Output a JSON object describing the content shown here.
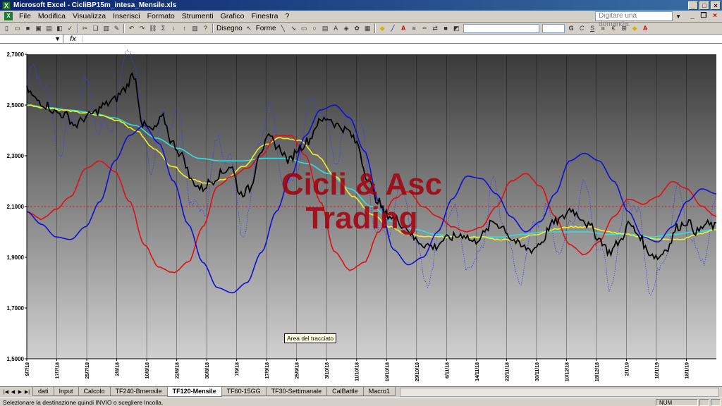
{
  "window": {
    "title": "Microsoft Excel - CicliBP15m_intesa_Mensile.xls",
    "app_glyph": "X"
  },
  "menu": {
    "items": [
      "File",
      "Modifica",
      "Visualizza",
      "Inserisci",
      "Formato",
      "Strumenti",
      "Grafico",
      "Finestra",
      "?"
    ],
    "ask_placeholder": "Digitare una domanda."
  },
  "toolbar": {
    "disegno_label": "Disegno",
    "forme_label": "Forme"
  },
  "formula": {
    "fx": "fx"
  },
  "chart": {
    "watermark_lines": [
      "Cicli & Asc",
      "Trading"
    ],
    "tooltip": "Area del tracciato",
    "reference_line": 2.1,
    "colors": {
      "price": "#000000",
      "dotted_cycle": "#4040e0",
      "blue_cycle": "#1010d0",
      "red_cycle": "#e01010",
      "yellow_avg": "#f0f020",
      "cyan_avg": "#30e0e0",
      "reference": "#c03030",
      "plot_top": "#3a3a3a",
      "plot_bottom": "#d0d0d0"
    }
  },
  "chart_data": {
    "type": "line",
    "ylim": [
      1.5,
      2.7
    ],
    "y_ticks": [
      "2,7000",
      "2,5000",
      "2,3000",
      "2,1000",
      "1,9000",
      "1,7000",
      "1,5000"
    ],
    "x_ticks": [
      "9/7/18",
      "17/7/18",
      "25/7/18",
      "2/8/18",
      "10/8/18",
      "22/8/18",
      "30/8/18",
      "7/9/18",
      "17/9/18",
      "25/9/18",
      "3/10/18",
      "11/10/18",
      "19/10/18",
      "29/10/18",
      "6/11/18",
      "14/11/18",
      "22/11/18",
      "30/11/18",
      "10/12/18",
      "18/12/18",
      "2/1/19",
      "10/1/19",
      "18/1/19"
    ],
    "series": [
      {
        "key": "price",
        "values": [
          2.56,
          2.52,
          2.5,
          2.47,
          2.46,
          2.42,
          2.45,
          2.47,
          2.5,
          2.52,
          2.56,
          2.62,
          2.42,
          2.4,
          2.45,
          2.35,
          2.3,
          2.2,
          2.17,
          2.2,
          2.23,
          2.26,
          2.15,
          2.17,
          2.32,
          2.37,
          2.33,
          2.28,
          2.33,
          2.36,
          2.43,
          2.45,
          2.42,
          2.4,
          2.35,
          2.22,
          2.13,
          2.07,
          2.05,
          2.02,
          1.97,
          1.95,
          1.94,
          1.97,
          1.98,
          1.99,
          1.96,
          1.99,
          2.04,
          2.02,
          1.97,
          1.94,
          1.93,
          1.96,
          2.03,
          2.05,
          2.09,
          2.06,
          2.02,
          1.97,
          1.92,
          1.96,
          2.03,
          1.99,
          1.92,
          1.9,
          1.94,
          2.02,
          2.04,
          2.0,
          2.03,
          2.02
        ]
      },
      {
        "key": "blue_cycle",
        "values": [
          2.08,
          2.03,
          1.98,
          1.97,
          2.02,
          2.12,
          2.28,
          2.38,
          2.42,
          2.35,
          2.2,
          2.03,
          1.88,
          1.78,
          1.76,
          1.8,
          1.92,
          2.08,
          2.22,
          2.38,
          2.48,
          2.5,
          2.45,
          2.32,
          2.12,
          1.93,
          1.87,
          1.9,
          2.0,
          2.13,
          2.22,
          2.21,
          2.15,
          2.06,
          2.0,
          2.04,
          2.15,
          2.28,
          2.31,
          2.28,
          2.2,
          2.08,
          1.98,
          1.96,
          2.02,
          2.12,
          2.17,
          2.15
        ]
      },
      {
        "key": "red_cycle",
        "values": [
          2.08,
          2.05,
          2.09,
          2.14,
          2.25,
          2.28,
          2.24,
          2.12,
          1.95,
          1.86,
          1.84,
          1.88,
          2.02,
          2.18,
          2.22,
          2.25,
          2.3,
          2.38,
          2.38,
          2.3,
          2.12,
          1.92,
          1.85,
          1.88,
          2.0,
          2.13,
          2.16,
          2.1,
          2.06,
          2.02,
          2.0,
          2.02,
          2.1,
          2.2,
          2.23,
          2.18,
          2.06,
          1.95,
          1.91,
          1.96,
          2.06,
          2.13,
          2.11,
          2.14,
          2.2,
          2.17,
          2.1,
          2.06
        ]
      },
      {
        "key": "yellow_avg",
        "values": [
          2.5,
          2.49,
          2.48,
          2.47,
          2.46,
          2.44,
          2.4,
          2.33,
          2.26,
          2.21,
          2.19,
          2.21,
          2.26,
          2.34,
          2.37,
          2.36,
          2.3,
          2.22,
          2.14,
          2.07,
          2.02,
          1.99,
          1.98,
          1.98,
          1.98,
          1.98,
          1.97,
          1.97,
          1.99,
          2.01,
          2.02,
          2.02,
          2.0,
          1.99,
          1.98,
          1.97,
          1.97,
          1.99,
          2.01
        ]
      },
      {
        "key": "cyan_avg",
        "values": [
          2.5,
          2.49,
          2.48,
          2.47,
          2.45,
          2.42,
          2.37,
          2.33,
          2.29,
          2.28,
          2.28,
          2.29,
          2.29,
          2.27,
          2.23,
          2.17,
          2.1,
          2.04,
          2.01,
          1.99,
          1.98,
          1.98,
          1.98,
          1.99,
          2.0,
          2.0,
          2.0,
          1.99,
          1.99,
          1.98,
          1.99,
          2.0,
          2.01
        ]
      }
    ]
  },
  "sheets": {
    "tabs": [
      "dati",
      "Input",
      "Calcolo",
      "TF240-Bmensile",
      "TF120-Mensile",
      "TF60-15GG",
      "TF30-Settimanale",
      "CalBattle",
      "Macro1"
    ],
    "active": "TF120-Mensile"
  },
  "status": {
    "text": "Selezionare la destinazione quindi INVIO o scegliere Incolla.",
    "num": "NUM"
  }
}
